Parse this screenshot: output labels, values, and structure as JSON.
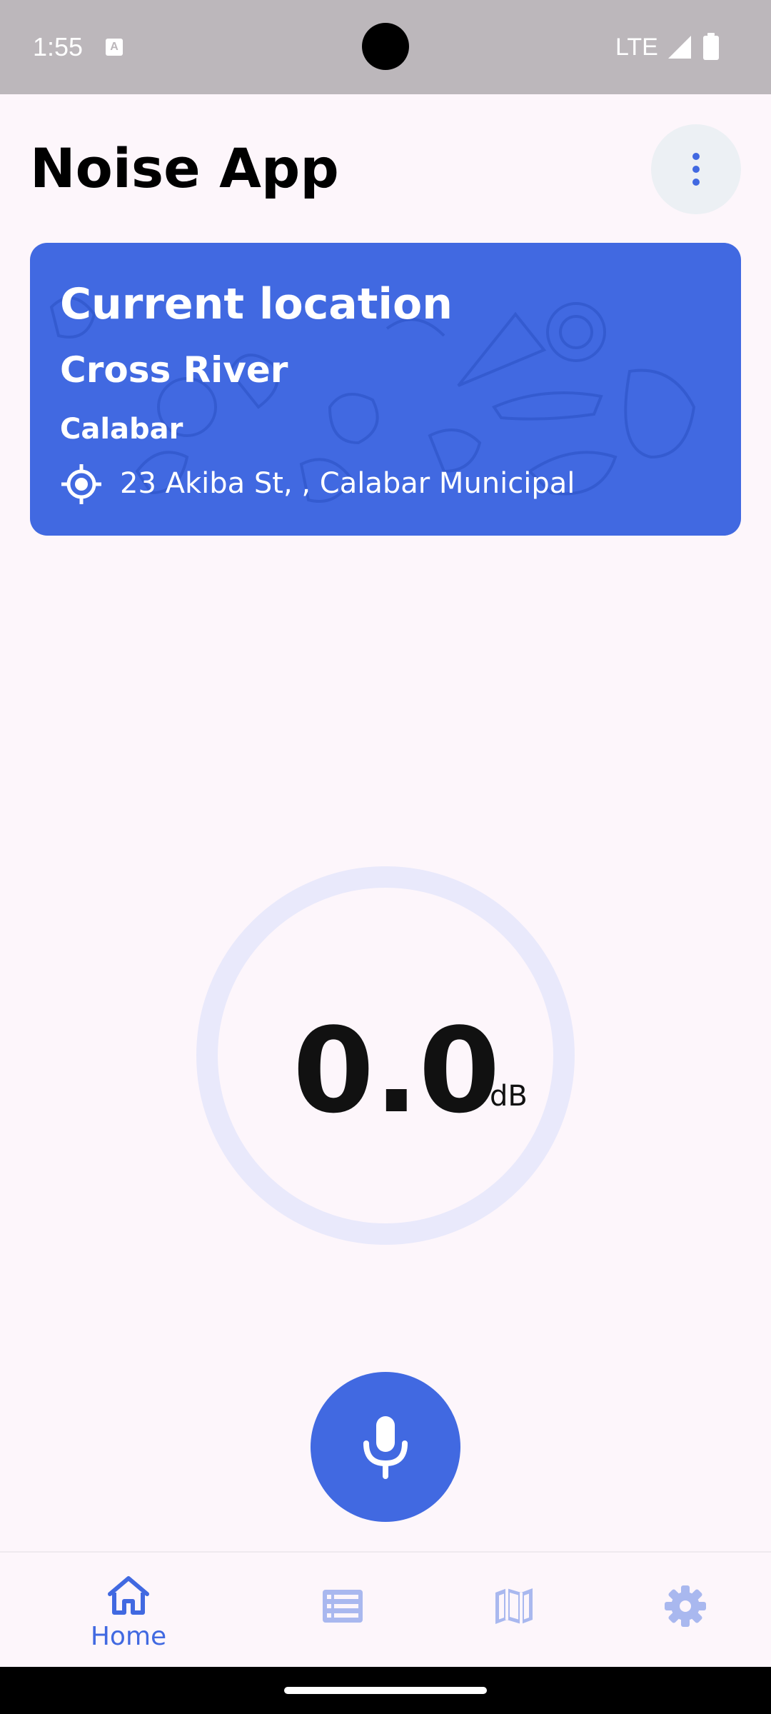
{
  "status_bar": {
    "time": "1:55",
    "network": "LTE"
  },
  "header": {
    "title": "Noise App"
  },
  "location_card": {
    "heading": "Current location",
    "state": "Cross River",
    "city": "Calabar",
    "address": "23 Akiba St, , Calabar Municipal"
  },
  "meter": {
    "value": "0.0",
    "unit": "dB"
  },
  "bottom_nav": {
    "items": [
      {
        "label": "Home",
        "icon": "home-icon",
        "active": true
      },
      {
        "label": "",
        "icon": "list-icon",
        "active": false
      },
      {
        "label": "",
        "icon": "map-icon",
        "active": false
      },
      {
        "label": "",
        "icon": "gear-icon",
        "active": false
      }
    ]
  },
  "colors": {
    "accent": "#4169e1",
    "background": "#fdf6fb",
    "gauge_ring": "#e9e9fb",
    "nav_inactive": "#a9b8ef"
  }
}
